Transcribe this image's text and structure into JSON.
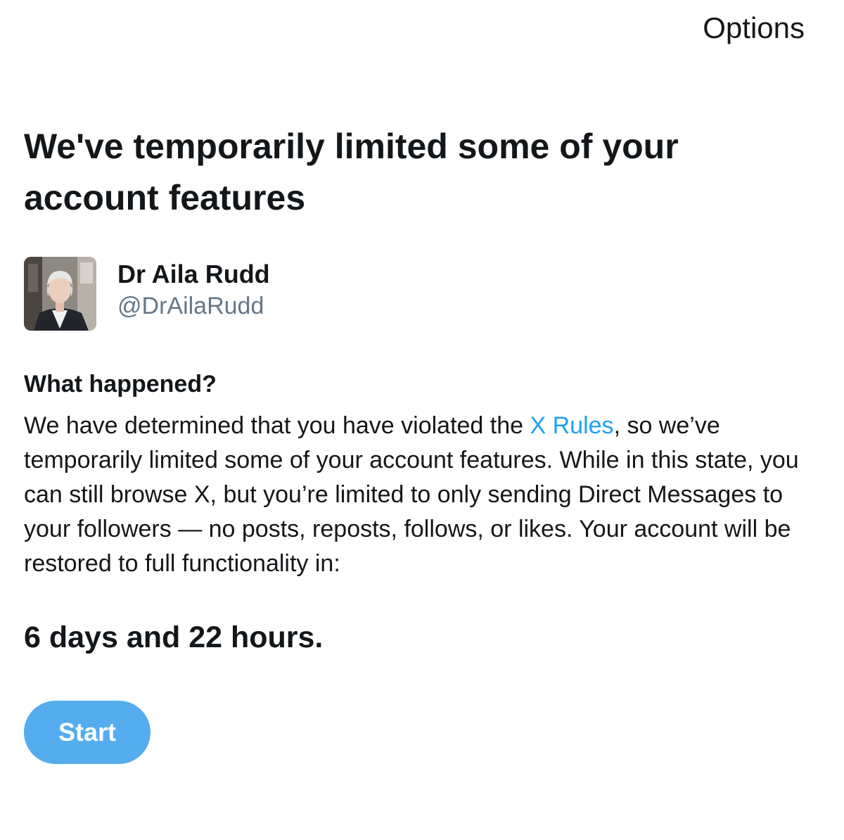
{
  "header": {
    "options_label": "Options"
  },
  "title": "We've temporarily limited some of your account features",
  "profile": {
    "display_name": "Dr Aila Rudd",
    "handle": "@DrAilaRudd",
    "avatar_icon": "profile-photo"
  },
  "details": {
    "heading": "What happened?",
    "text_before_link": "We have determined that you have violated the ",
    "link_text": "X Rules",
    "text_after_link": ", so we’ve temporarily limited some of your account features. While in this state, you can still browse X, but you’re limited to only sending Direct Messages to your followers — no posts, reposts, follows, or likes. Your account will be restored to full functionality in:"
  },
  "countdown": "6 days and 22 hours.",
  "actions": {
    "start_label": "Start"
  },
  "colors": {
    "link": "#1da1f2",
    "button": "#55acee",
    "secondary_text": "#657786",
    "primary_text": "#14171a"
  }
}
